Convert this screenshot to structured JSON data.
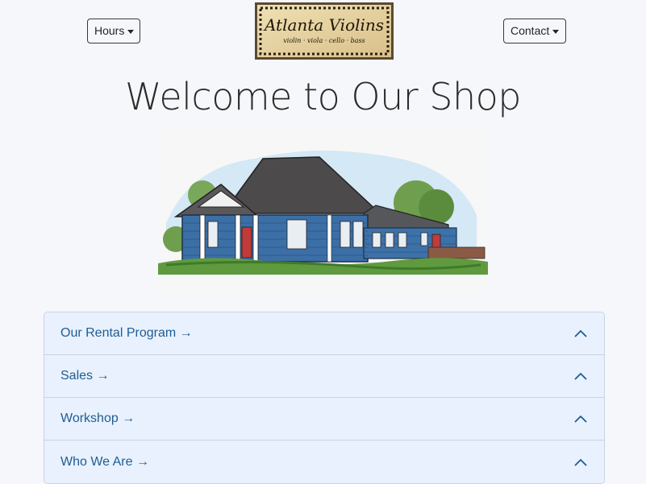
{
  "nav": {
    "hours_label": "Hours",
    "contact_label": "Contact"
  },
  "logo": {
    "title": "Atlanta Violins",
    "subtitle": "violin · viola · cello · bass"
  },
  "page_title": "Welcome to Our Shop",
  "accordion": {
    "items": [
      {
        "label": "Our Rental Program →"
      },
      {
        "label": "Sales →"
      },
      {
        "label": "Workshop →"
      },
      {
        "label": "Who We Are →"
      }
    ]
  },
  "colors": {
    "accent_text": "#1f5c94",
    "accordion_bg": "#e8f1fd",
    "house_blue": "#3b6fa6"
  }
}
